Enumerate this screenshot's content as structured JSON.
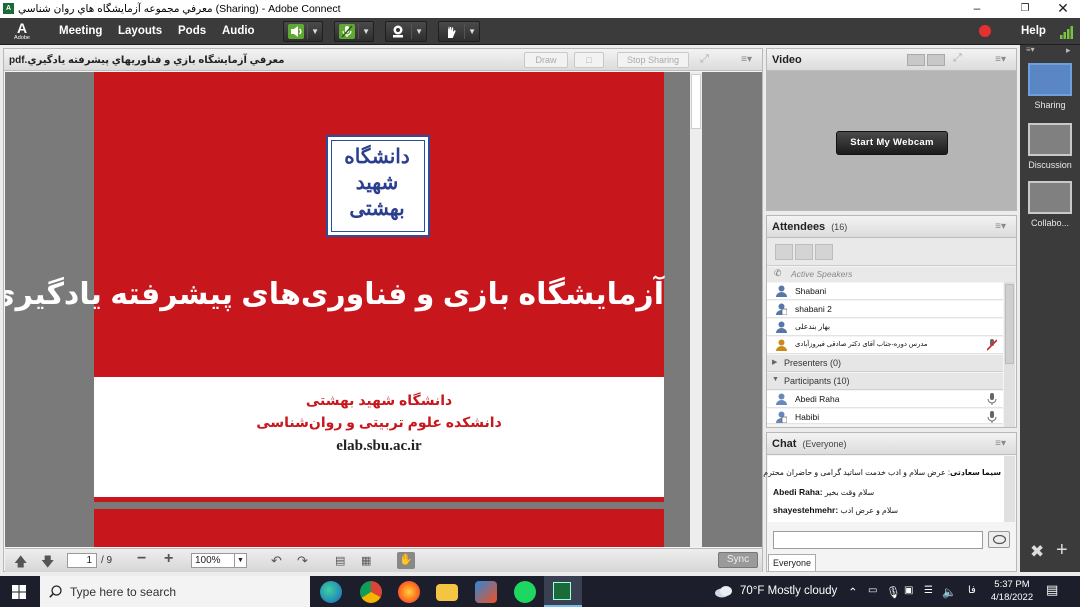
{
  "window": {
    "title": "معرفي مجموعه آزمايشگاه هاي روان شناسي (Sharing) - Adobe Connect",
    "app_icon": "adobe-connect-icon"
  },
  "menubar": {
    "logo_letter": "A",
    "logo_text": "Adobe",
    "items": [
      "Meeting",
      "Layouts",
      "Pods",
      "Audio"
    ],
    "help": "Help"
  },
  "share_pod": {
    "filename": "معرفي آزمايشگاه بازي و فناوريهاي پيشرفته يادگيري.pdf",
    "draw_label": "Draw",
    "stop_sharing_label": "Stop Sharing",
    "slide": {
      "logo_text_1": "دانشگاه",
      "logo_text_2": "شهید",
      "logo_text_3": "بهشتی",
      "title": "آزمایشگاه بازی و فناوری‌های پیشرفته یادگیری",
      "university": "دانشگاه شهید بهشتی",
      "faculty": "دانشکده علوم تربیتی و روان‌شناسی",
      "url": "elab.sbu.ac.ir"
    },
    "footer": {
      "page": "1",
      "total": "/ 9",
      "zoom": "100%",
      "sync_label": "Sync"
    }
  },
  "video_pod": {
    "title": "Video",
    "start_webcam": "Start My Webcam"
  },
  "attendees_pod": {
    "title": "Attendees",
    "count": "(16)",
    "active_speakers": "Active Speakers",
    "hosts": [
      {
        "name": "Shabani"
      },
      {
        "name": "shabani 2"
      },
      {
        "name": "بهار بندعلی"
      },
      {
        "name": "مدرس دوره-جناب آقای دکتر صادقی فیروزآبادی"
      }
    ],
    "presenters": "Presenters (0)",
    "participants": "Participants (10)",
    "participant_list": [
      {
        "name": "Abedi Raha"
      },
      {
        "name": "Habibi"
      }
    ]
  },
  "chat_pod": {
    "title": "Chat",
    "scope": "(Everyone)",
    "messages": [
      {
        "sender": "سیما سعادتی",
        "text": "عرض سلام و ادب خدمت اساتید گرامی و حاضران محترم"
      },
      {
        "sender": "Abedi Raha:",
        "text": "سلام وقت بخیر"
      },
      {
        "sender": "shayestehmehr:",
        "text": "سلام و عرض ادب"
      }
    ],
    "tab": "Everyone"
  },
  "layouts": [
    {
      "label": "Sharing",
      "selected": true
    },
    {
      "label": "Discussion",
      "selected": false
    },
    {
      "label": "Collabo...",
      "selected": false
    }
  ],
  "taskbar": {
    "search_placeholder": "Type here to search",
    "weather": "70°F  Mostly cloudy",
    "lang": "فا",
    "time": "5:37 PM",
    "date": "4/18/2022"
  },
  "colors": {
    "slide_red": "#c8161d",
    "logo_blue": "#2b3f8e",
    "dark_chrome": "#3b3b3b",
    "record_red": "#e53030",
    "speaker_green": "#7bc142"
  }
}
